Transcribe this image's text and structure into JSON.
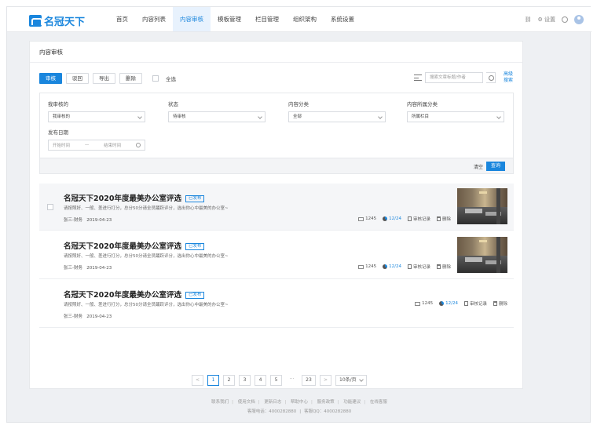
{
  "brand": {
    "name": "名冠天下"
  },
  "nav": {
    "items": [
      "首页",
      "内容列表",
      "内容审核",
      "模板管理",
      "栏目管理",
      "组织架构",
      "系统设置"
    ],
    "active_index": 2,
    "settings_label": "设置"
  },
  "card": {
    "title": "内容审核"
  },
  "toolbar": {
    "approve": "审核",
    "reject": "驳回",
    "export": "导出",
    "delete": "删除",
    "select_all": "全选",
    "search_placeholder": "搜索文章标题/作者",
    "advanced_search": "高级搜索"
  },
  "filter": {
    "org_label": "我审核的",
    "org_value": "我审核的",
    "status_label": "状态",
    "status_value": "待审核",
    "category_label": "内容分类",
    "category_value": "全部",
    "column_label": "内容所属分类",
    "column_value": "所属栏目",
    "date_label": "发布日期",
    "date_start": "开始时间",
    "date_sep": "—",
    "date_end": "结束时间",
    "clear": "清空",
    "query": "查询"
  },
  "list": [
    {
      "title": "名冠天下2020年度最美办公室评选",
      "badge": "已发布",
      "desc": "请按照好、一般、差进行打分，总分50分请全员踊跃评分，选出你心中最美的办公室~",
      "author": "张三",
      "dept": "财务",
      "date": "2019-04-23",
      "comments": "1245",
      "reads": "12/24",
      "audit": "审核记录",
      "delete": "删除",
      "has_image": true
    },
    {
      "title": "名冠天下2020年度最美办公室评选",
      "badge": "已发布",
      "desc": "请按照好、一般、差进行打分，总分50分请全员踊跃评分，选出你心中最美的办公室~",
      "author": "张三",
      "dept": "财务",
      "date": "2019-04-23",
      "comments": "1245",
      "reads": "12/24",
      "audit": "审核记录",
      "delete": "删除",
      "has_image": true
    },
    {
      "title": "名冠天下2020年度最美办公室评选",
      "badge": "已发布",
      "desc": "请按照好、一般、差进行打分，总分50分请全员踊跃评分，选出你心中最美的办公室~",
      "author": "张三",
      "dept": "财务",
      "date": "2019-04-23",
      "comments": "1245",
      "reads": "12/24",
      "audit": "审核记录",
      "delete": "删除",
      "has_image": false
    }
  ],
  "pager": {
    "prev": "<",
    "pages": [
      "1",
      "2",
      "3",
      "4",
      "5"
    ],
    "current": "1",
    "ellipsis": "···",
    "last": "23",
    "next": ">",
    "page_size": "10条/页"
  },
  "footer": {
    "links": [
      "联系我们",
      "使用文档",
      "更新日志",
      "帮助中心",
      "服务政策",
      "功能建议",
      "在线客服"
    ],
    "phone": "客服电话：4000282880",
    "qq": "客服QQ：4000282880"
  },
  "colors": {
    "accent": "#1a86dd"
  }
}
